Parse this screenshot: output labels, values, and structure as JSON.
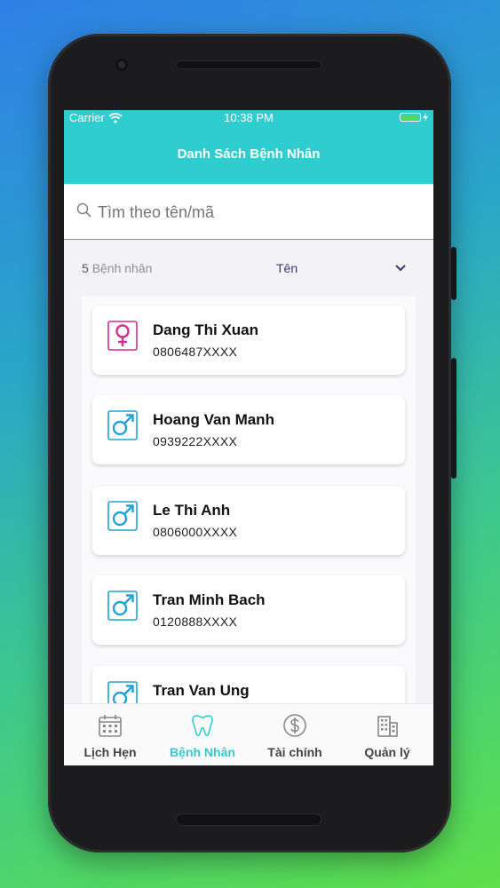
{
  "status_bar": {
    "carrier": "Carrier",
    "time": "10:38 PM"
  },
  "header": {
    "title": "Danh Sách Bệnh Nhân"
  },
  "search": {
    "placeholder": "Tìm theo tên/mã"
  },
  "list_bar": {
    "count": "5",
    "count_label": "Bệnh nhân",
    "sort_label": "Tên"
  },
  "patients": [
    {
      "name": "Dang Thi Xuan",
      "phone": "0806487XXXX",
      "gender": "female-icon"
    },
    {
      "name": "Hoang Van Manh",
      "phone": "0939222XXXX",
      "gender": "male-icon"
    },
    {
      "name": "Le Thi Anh",
      "phone": "0806000XXXX",
      "gender": "male-icon"
    },
    {
      "name": "Tran Minh Bach",
      "phone": "0120888XXXX",
      "gender": "male-icon"
    },
    {
      "name": "Tran Van Ung",
      "phone": "",
      "gender": "male-icon"
    }
  ],
  "tabs": [
    {
      "label": "Lịch Hẹn",
      "icon": "calendar-icon"
    },
    {
      "label": "Bệnh Nhân",
      "icon": "tooth-icon",
      "active": true
    },
    {
      "label": "Tài chính",
      "icon": "dollar-icon"
    },
    {
      "label": "Quản lý",
      "icon": "building-icon"
    }
  ],
  "colors": {
    "accent": "#2fcdd0",
    "female": "#d22f8f",
    "male": "#1ea3d6"
  }
}
